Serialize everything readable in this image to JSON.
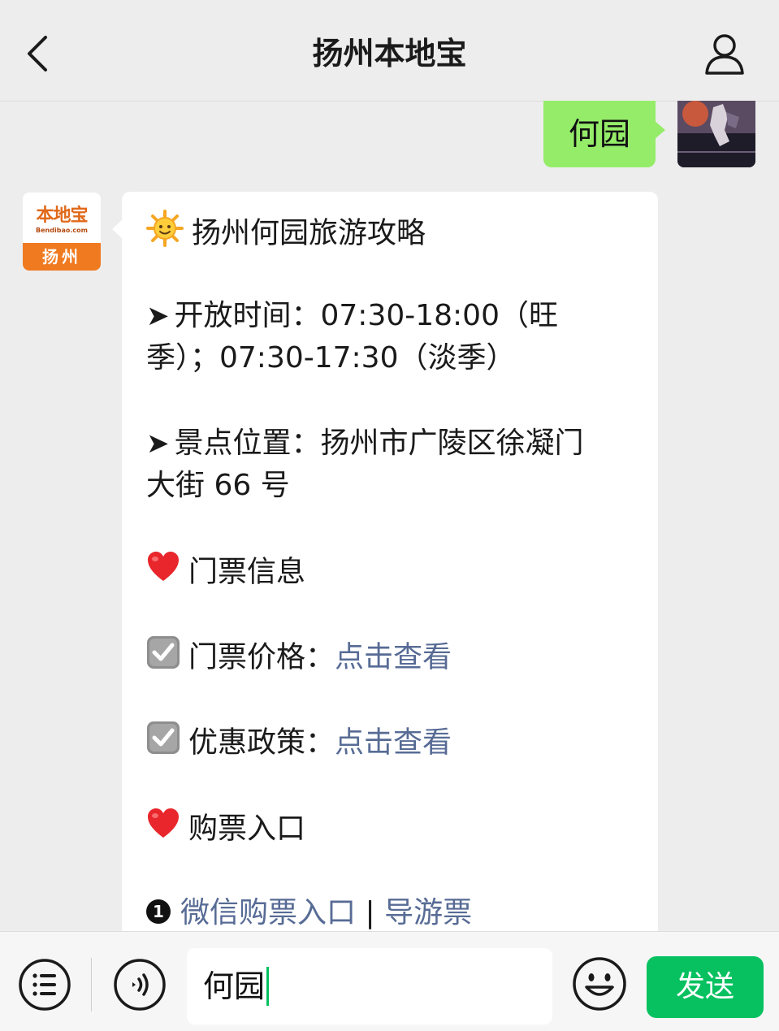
{
  "header": {
    "title": "扬州本地宝"
  },
  "user_message": {
    "text": "何园"
  },
  "bot": {
    "avatar": {
      "logo_cn": "本地宝",
      "logo_en": "Bendibao.com",
      "city": "扬州"
    },
    "lines": {
      "title": "扬州何园旅游攻略",
      "hours_line1": "开放时间：07:30-18:00（旺",
      "hours_line2": "季）；07:30-17:30（淡季）",
      "location_line1": "景点位置：扬州市广陵区徐凝门",
      "location_line2": "大街 66 号",
      "ticket_info": "门票信息",
      "ticket_price_label": "门票价格：",
      "ticket_price_link": "点击查看",
      "discount_label": "优惠政策：",
      "discount_link": "点击查看",
      "purchase_entry": "购票入口",
      "entry_number": "1",
      "wechat_purchase_link": "微信购票入口",
      "separator": "|",
      "guide_ticket_link": "导游票"
    }
  },
  "input_bar": {
    "text_value": "何园",
    "send_label": "发送"
  },
  "colors": {
    "user_bubble": "#95ec69",
    "link": "#576b95",
    "send_button": "#07c160",
    "brand_orange": "#f07a20"
  },
  "icons": [
    "back-arrow-icon",
    "profile-icon",
    "sun-emoji-icon",
    "arrow-bullet-icon",
    "heart-emoji-icon",
    "checkbox-emoji-icon",
    "menu-list-icon",
    "voice-icon",
    "emoji-face-icon"
  ]
}
